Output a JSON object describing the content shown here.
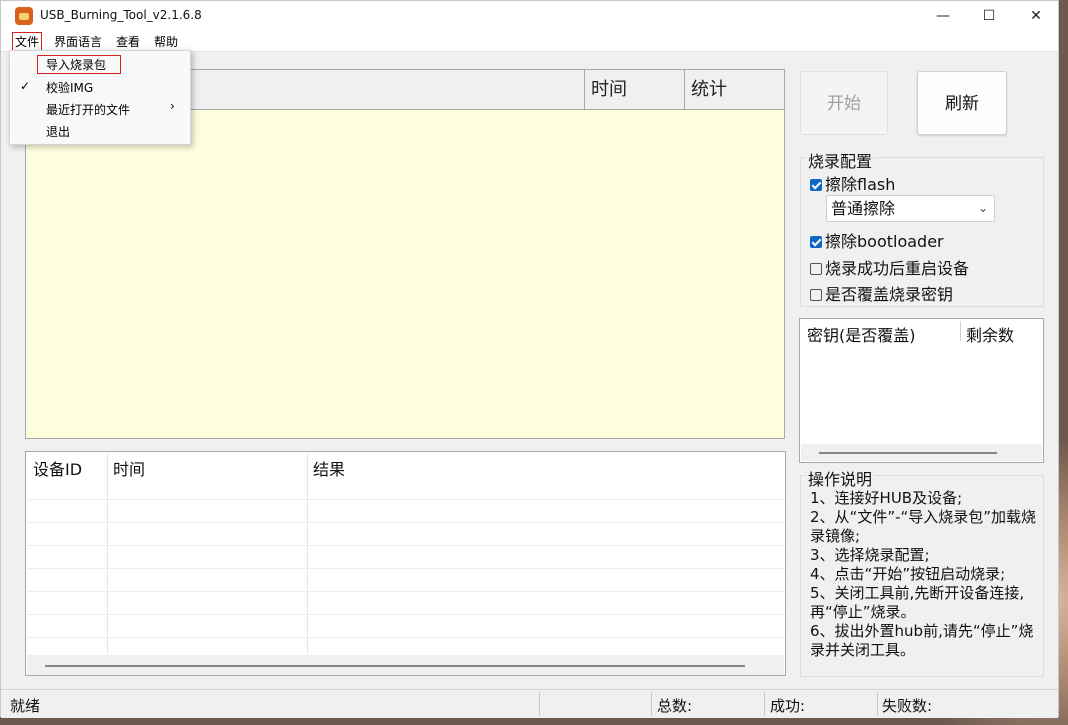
{
  "window": {
    "title": "USB_Burning_Tool_v2.1.6.8",
    "min_glyph": "—",
    "max_glyph": "☐",
    "close_glyph": "✕"
  },
  "menubar": {
    "items": [
      "文件",
      "界面语言",
      "查看",
      "帮助"
    ]
  },
  "file_menu": {
    "items": [
      "导入烧录包",
      "校验IMG",
      "最近打开的文件",
      "退出"
    ],
    "checked_item": "校验IMG",
    "check_glyph": "✓",
    "submenu_glyph": "›"
  },
  "file_table": {
    "columns": [
      "",
      "时间",
      "统计"
    ],
    "background": "#fefedf"
  },
  "result_table": {
    "columns": [
      "设备ID",
      "时间",
      "结果"
    ]
  },
  "buttons": {
    "start": "开始",
    "refresh": "刷新"
  },
  "burn_config": {
    "title": "烧录配置",
    "erase_flash": {
      "label": "擦除flash",
      "checked": true
    },
    "erase_mode": "普通擦除",
    "erase_bootloader": {
      "label": "擦除bootloader",
      "checked": true
    },
    "reboot_after": {
      "label": "烧录成功后重启设备",
      "checked": false
    },
    "overwrite_key": {
      "label": "是否覆盖烧录密钥",
      "checked": false
    }
  },
  "key_table": {
    "columns": [
      "密钥(是否覆盖)",
      "剩余数"
    ]
  },
  "instructions": {
    "title": "操作说明",
    "lines": [
      "1、连接好HUB及设备;",
      "2、从“文件”-“导入烧录包”加载烧录镜像;",
      "3、选择烧录配置;",
      "4、点击“开始”按钮启动烧录;",
      "5、关闭工具前,先断开设备连接,再“停止”烧录。",
      "6、拔出外置hub前,请先“停止”烧录并关闭工具。"
    ]
  },
  "statusbar": {
    "status": "就绪",
    "total": "总数:",
    "success": "成功:",
    "failed": "失败数:"
  },
  "colors": {
    "accent": "#0f66c4",
    "highlight_border": "#d62020"
  }
}
